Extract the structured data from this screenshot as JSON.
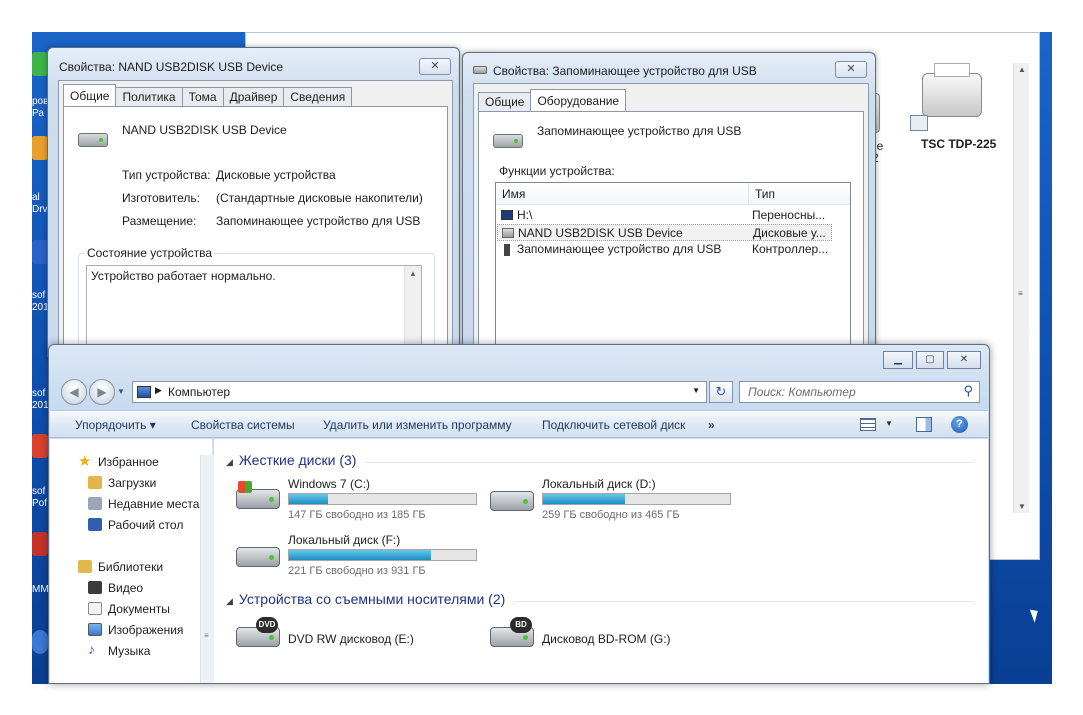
{
  "dialog1": {
    "title": "Свойства: NAND USB2DISK USB Device",
    "close": "✕",
    "tabs": [
      "Общие",
      "Политика",
      "Тома",
      "Драйвер",
      "Сведения"
    ],
    "device_name": "NAND USB2DISK USB Device",
    "props": [
      {
        "label": "Тип устройства:",
        "value": "Дисковые устройства"
      },
      {
        "label": "Изготовитель:",
        "value": "(Стандартные дисковые накопители)"
      },
      {
        "label": "Размещение:",
        "value": "Запоминающее устройство для USB"
      }
    ],
    "status_group": "Состояние устройства",
    "status_text": "Устройство работает нормально."
  },
  "dialog2": {
    "title": "Свойства: Запоминающее устройство для USB",
    "close": "✕",
    "tabs": [
      "Общие",
      "Оборудование"
    ],
    "device_name": "Запоминающее устройство для USB",
    "functions_label": "Функции устройства:",
    "columns": [
      "Имя",
      "Тип"
    ],
    "rows": [
      {
        "name": "H:\\",
        "type": "Переносны...",
        "icon": "drive-letter-icon"
      },
      {
        "name": "NAND USB2DISK USB Device",
        "type": "Дисковые у...",
        "icon": "disk-drive-icon",
        "selected": true
      },
      {
        "name": "Запоминающее устройство для USB",
        "type": "Контроллер...",
        "icon": "usb-plug-icon"
      }
    ]
  },
  "background": {
    "printer_name": "TSC TDP-225",
    "partial_label_1": "ge",
    "partial_label_2": "2"
  },
  "desktop_icons": [
    "ров",
    "Ра",
    "al",
    "Drv",
    "sof",
    "201",
    "sof",
    "201",
    "sof",
    "Рof",
    "ММ"
  ],
  "explorer": {
    "caption_buttons": {
      "minimize": "▁",
      "maximize": "▢",
      "close": "✕"
    },
    "address": "Компьютер",
    "search_placeholder": "Поиск: Компьютер",
    "commands": {
      "organize": "Упорядочить ▾",
      "system_props": "Свойства системы",
      "uninstall": "Удалить или изменить программу",
      "map_drive": "Подключить сетевой диск",
      "more": "»"
    },
    "nav": {
      "favorites": "Избранное",
      "downloads": "Загрузки",
      "recent": "Недавние места",
      "desktop": "Рабочий стол",
      "libraries": "Библиотеки",
      "video": "Видео",
      "documents": "Документы",
      "pictures": "Изображения",
      "music": "Музыка"
    },
    "group_hdd": "Жесткие диски (3)",
    "group_removable": "Устройства со съемными носителями (2)",
    "drives": [
      {
        "name": "Windows 7 (C:)",
        "free": "147 ГБ свободно из 185 ГБ",
        "used_fraction": 0.21
      },
      {
        "name": "Локальный диск (D:)",
        "free": "259 ГБ свободно из 465 ГБ",
        "used_fraction": 0.44
      },
      {
        "name": "Локальный диск (F:)",
        "free": "221 ГБ свободно из 931 ГБ",
        "used_fraction": 0.76
      }
    ],
    "removable": [
      {
        "name": "DVD RW дисковод (E:)",
        "badge": "DVD"
      },
      {
        "name": "Дисковод BD-ROM (G:)",
        "badge": "BD"
      }
    ]
  },
  "colors": {
    "desktop": "#1460c4",
    "bar_fill": "#26a0da",
    "group_header": "#1e3287"
  }
}
